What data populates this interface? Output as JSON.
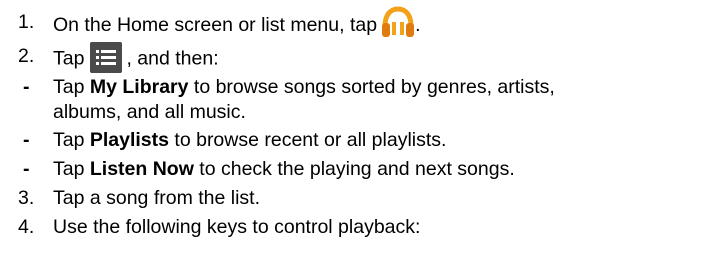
{
  "steps": [
    {
      "marker": "1.",
      "before": "On the Home screen or list menu, tap",
      "icon": "play-music-headphones-icon",
      "after": "."
    },
    {
      "marker": "2.",
      "before": "Tap",
      "icon": "menu-list-icon",
      "after": ", and then:"
    }
  ],
  "bullets": [
    {
      "marker": "-",
      "prefix": "Tap ",
      "bold": "My Library",
      "rest": " to browse songs sorted by genres, artists,",
      "continuation": "albums, and all music."
    },
    {
      "marker": "-",
      "prefix": "Tap ",
      "bold": "Playlists",
      "rest": " to browse recent or all playlists."
    },
    {
      "marker": "-",
      "prefix": "Tap ",
      "bold": "Listen Now",
      "rest": " to check the playing and next songs."
    }
  ],
  "later_steps": [
    {
      "marker": "3.",
      "text": "Tap a song from the list."
    },
    {
      "marker": "4.",
      "text": "Use the following keys to control playback:"
    }
  ],
  "colors": {
    "icon_orange": "#F4A11A",
    "icon_orange_dark": "#E07B10",
    "menu_bg": "#4A4A4A"
  }
}
